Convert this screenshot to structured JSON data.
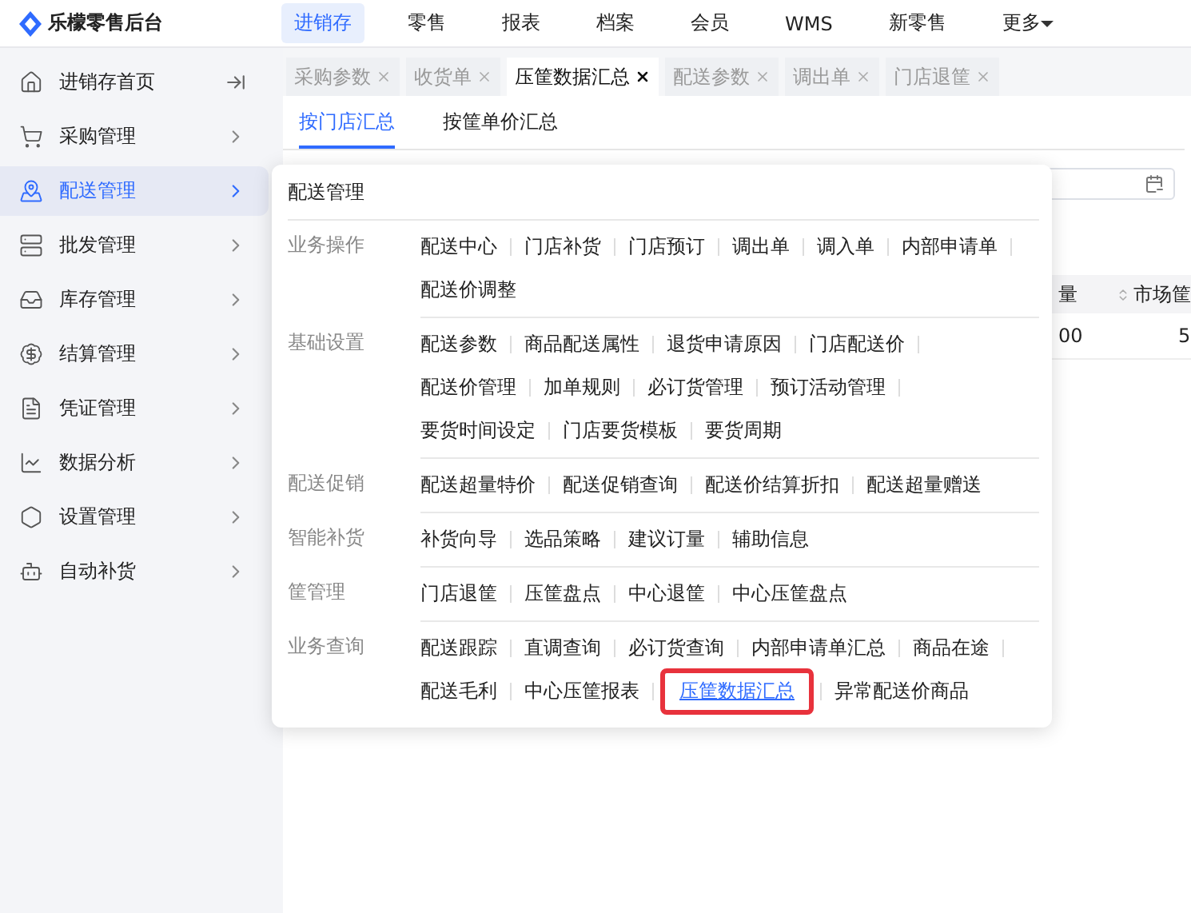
{
  "brand": {
    "name": "乐檬零售后台"
  },
  "top_nav": [
    {
      "label": "进销存",
      "selected": true
    },
    {
      "label": "零售",
      "selected": false
    },
    {
      "label": "报表",
      "selected": false
    },
    {
      "label": "档案",
      "selected": false
    },
    {
      "label": "会员",
      "selected": false
    },
    {
      "label": "WMS",
      "selected": false
    },
    {
      "label": "新零售",
      "selected": false
    },
    {
      "label": "更多",
      "selected": false,
      "dropdown": true
    }
  ],
  "sidebar": {
    "items": [
      {
        "label": "进销存首页",
        "selected": false,
        "kind": "home"
      },
      {
        "label": "采购管理",
        "selected": false,
        "kind": "menu"
      },
      {
        "label": "配送管理",
        "selected": true,
        "kind": "menu"
      },
      {
        "label": "批发管理",
        "selected": false,
        "kind": "menu"
      },
      {
        "label": "库存管理",
        "selected": false,
        "kind": "menu"
      },
      {
        "label": "结算管理",
        "selected": false,
        "kind": "menu"
      },
      {
        "label": "凭证管理",
        "selected": false,
        "kind": "menu"
      },
      {
        "label": "数据分析",
        "selected": false,
        "kind": "menu"
      },
      {
        "label": "设置管理",
        "selected": false,
        "kind": "menu"
      },
      {
        "label": "自动补货",
        "selected": false,
        "kind": "menu"
      }
    ]
  },
  "page_tabs": [
    {
      "label": "采购参数",
      "selected": false
    },
    {
      "label": "收货单",
      "selected": false
    },
    {
      "label": "压筐数据汇总",
      "selected": true
    },
    {
      "label": "配送参数",
      "selected": false
    },
    {
      "label": "调出单",
      "selected": false
    },
    {
      "label": "门店退筐",
      "selected": false
    }
  ],
  "sub_tabs": [
    {
      "label": "按门店汇总",
      "selected": true
    },
    {
      "label": "按筐单价汇总",
      "selected": false
    }
  ],
  "table": {
    "columns": [
      "量",
      "市场筐"
    ],
    "rows": [
      [
        "00",
        "5"
      ]
    ]
  },
  "menu": {
    "title": "配送管理",
    "groups": [
      {
        "label": "业务操作",
        "rows": [
          [
            {
              "label": "配送中心",
              "selected": false
            },
            {
              "label": "门店补货",
              "selected": false
            },
            {
              "label": "门店预订",
              "selected": false
            },
            {
              "label": "调出单",
              "selected": false
            },
            {
              "label": "调入单",
              "selected": false
            },
            {
              "label": "内部申请单",
              "selected": false
            }
          ],
          [
            {
              "label": "配送价调整",
              "selected": false
            }
          ]
        ]
      },
      {
        "label": "基础设置",
        "rows": [
          [
            {
              "label": "配送参数",
              "selected": false
            },
            {
              "label": "商品配送属性",
              "selected": false
            },
            {
              "label": "退货申请原因",
              "selected": false
            },
            {
              "label": "门店配送价",
              "selected": false
            }
          ],
          [
            {
              "label": "配送价管理",
              "selected": false
            },
            {
              "label": "加单规则",
              "selected": false
            },
            {
              "label": "必订货管理",
              "selected": false
            },
            {
              "label": "预订活动管理",
              "selected": false
            }
          ],
          [
            {
              "label": "要货时间设定",
              "selected": false
            },
            {
              "label": "门店要货模板",
              "selected": false
            },
            {
              "label": "要货周期",
              "selected": false
            }
          ]
        ]
      },
      {
        "label": "配送促销",
        "rows": [
          [
            {
              "label": "配送超量特价",
              "selected": false
            },
            {
              "label": "配送促销查询",
              "selected": false
            },
            {
              "label": "配送价结算折扣",
              "selected": false
            },
            {
              "label": "配送超量赠送",
              "selected": false
            }
          ]
        ]
      },
      {
        "label": "智能补货",
        "rows": [
          [
            {
              "label": "补货向导",
              "selected": false
            },
            {
              "label": "选品策略",
              "selected": false
            },
            {
              "label": "建议订量",
              "selected": false
            },
            {
              "label": "辅助信息",
              "selected": false
            }
          ]
        ]
      },
      {
        "label": "筐管理",
        "rows": [
          [
            {
              "label": "门店退筐",
              "selected": false
            },
            {
              "label": "压筐盘点",
              "selected": false
            },
            {
              "label": "中心退筐",
              "selected": false
            },
            {
              "label": "中心压筐盘点",
              "selected": false
            }
          ]
        ]
      },
      {
        "label": "业务查询",
        "rows": [
          [
            {
              "label": "配送跟踪",
              "selected": false
            },
            {
              "label": "直调查询",
              "selected": false
            },
            {
              "label": "必订货查询",
              "selected": false
            },
            {
              "label": "内部申请单汇总",
              "selected": false
            },
            {
              "label": "商品在途",
              "selected": false
            }
          ],
          [
            {
              "label": "配送毛利",
              "selected": false
            },
            {
              "label": "中心压筐报表",
              "selected": false
            },
            {
              "label": "压筐数据汇总",
              "selected": true
            },
            {
              "label": "异常配送价商品",
              "selected": false
            }
          ]
        ]
      }
    ]
  }
}
